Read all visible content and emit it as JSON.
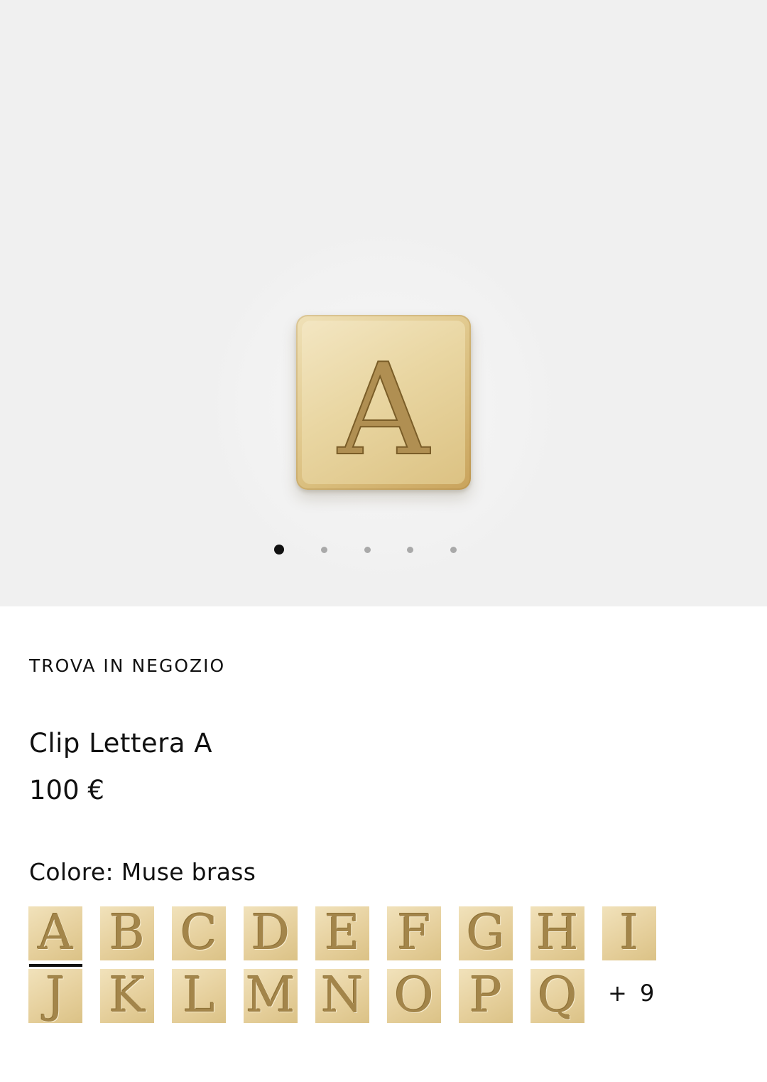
{
  "hero": {
    "tile_letter": "A",
    "dots": [
      {
        "active": true
      },
      {
        "active": false
      },
      {
        "active": false
      },
      {
        "active": false
      },
      {
        "active": false
      }
    ]
  },
  "product": {
    "store_link": "TROVA IN NEGOZIO",
    "title": "Clip Lettera A",
    "price": "100 €",
    "color_label": "Colore: Muse brass"
  },
  "letters": {
    "row1": [
      "A",
      "B",
      "C",
      "D",
      "E",
      "F",
      "G",
      "H",
      "I"
    ],
    "row2": [
      "J",
      "K",
      "L",
      "M",
      "N",
      "O",
      "P",
      "Q"
    ],
    "selected": "A",
    "more_label": "+ 9"
  },
  "colors": {
    "gold_light": "#f1e2bb",
    "gold_dark": "#a3854a",
    "hero_bg": "#f0f0f0"
  }
}
